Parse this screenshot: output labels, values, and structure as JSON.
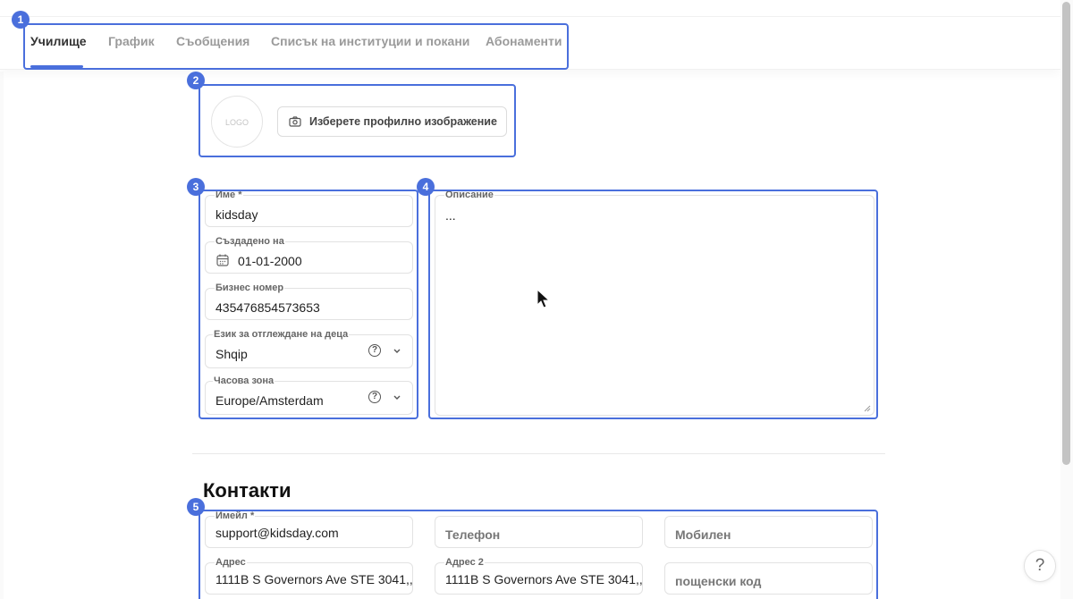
{
  "tabs": [
    {
      "label": "Училище",
      "active": true
    },
    {
      "label": "График",
      "active": false
    },
    {
      "label": "Съобщения",
      "active": false
    },
    {
      "label": "Списък на институции и покани",
      "active": false
    },
    {
      "label": "Абонаменти",
      "active": false
    }
  ],
  "annotations": [
    "1",
    "2",
    "3",
    "4",
    "5"
  ],
  "profile": {
    "logo_text": "LOGO",
    "upload_label": "Изберете профилно изображение",
    "upload_icon": "camera-icon"
  },
  "form": {
    "name": {
      "label": "Име *",
      "value": "kidsday"
    },
    "created": {
      "label": "Създадено на",
      "value": "01-01-2000",
      "icon": "calendar-icon"
    },
    "business_number": {
      "label": "Бизнес номер",
      "value": "435476854573653"
    },
    "language": {
      "label": "Език за отглеждане на деца",
      "value": "Shqip",
      "help": "?"
    },
    "timezone": {
      "label": "Часова зона",
      "value": "Europe/Amsterdam",
      "help": "?"
    },
    "description": {
      "label": "Описание",
      "value": "..."
    }
  },
  "contacts": {
    "title": "Контакти",
    "email": {
      "label": "Имейл *",
      "value": "support@kidsday.com"
    },
    "phone": {
      "placeholder": "Телефон"
    },
    "mobile": {
      "placeholder": "Мобилен"
    },
    "address": {
      "label": "Адрес",
      "value": "1111B S Governors Ave STE 3041,,"
    },
    "address2": {
      "label": "Адрес 2",
      "value": "1111B S Governors Ave STE 3041,,"
    },
    "postal": {
      "placeholder": "пощенски код"
    }
  },
  "help_button": "?",
  "colors": {
    "accent": "#4a6fdc",
    "muted_tab": "#9a9a9a",
    "active_tab": "#333333"
  }
}
